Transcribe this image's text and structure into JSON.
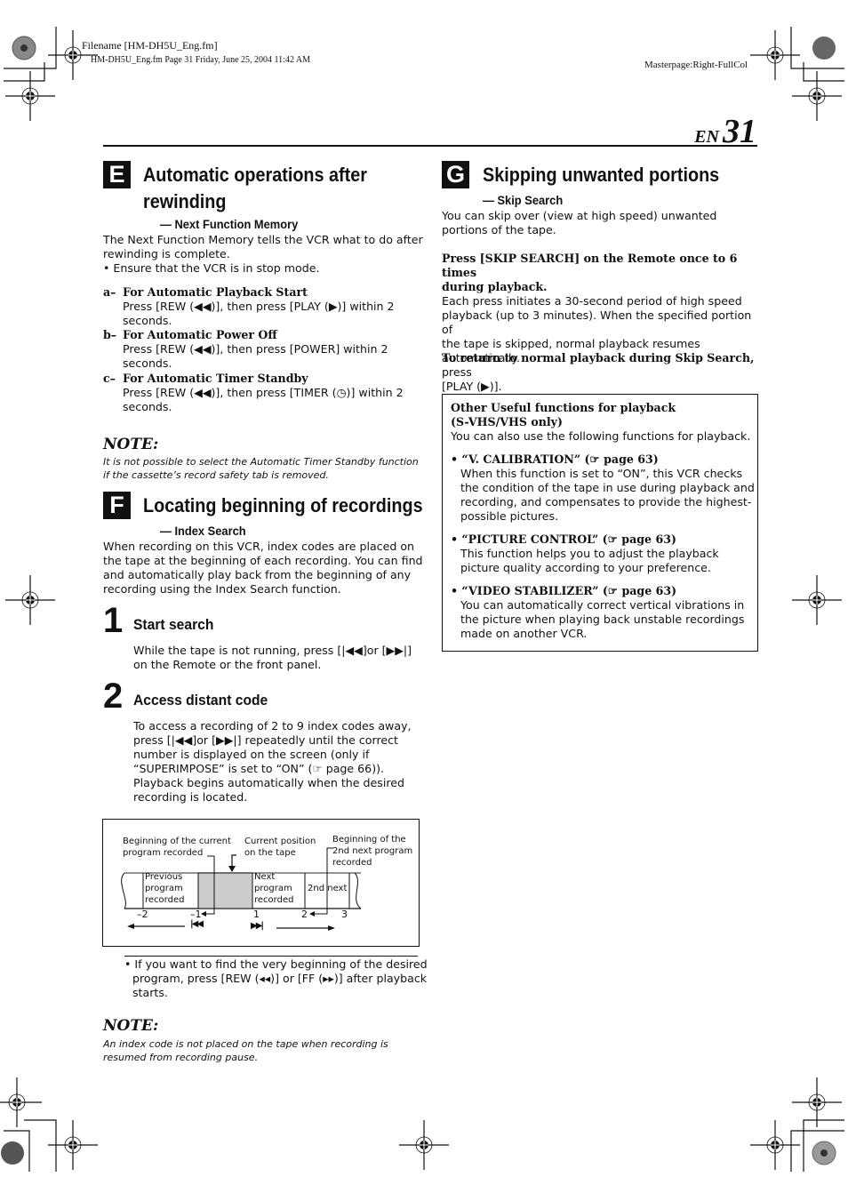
{
  "print_meta": {
    "filename": "Filename [HM-DH5U_Eng.fm]",
    "file_info": "HM-DH5U_Eng.fm  Page 31  Friday, June 25, 2004  11:42 AM",
    "masterpage": "Masterpage:Right-FullCol"
  },
  "page_number": {
    "lang": "EN",
    "number": "31"
  },
  "section_e": {
    "letter": "E",
    "title_line1": "Automatic operations after",
    "title_line2": "rewinding",
    "subtitle": "— Next Function Memory",
    "intro_line1": "The Next Function Memory tells the VCR what to do after",
    "intro_line2": "rewinding is complete.",
    "bullet": "• Ensure that the VCR is in stop mode.",
    "items": [
      {
        "marker": "a–",
        "title": "For Automatic Playback Start",
        "line1": "Press [REW (◀◀)], then press [PLAY (▶)] within 2",
        "line2": "seconds."
      },
      {
        "marker": "b–",
        "title": "For Automatic Power Off",
        "line1": "Press [REW (◀◀)], then press [POWER] within 2",
        "line2": "seconds."
      },
      {
        "marker": "c–",
        "title": "For Automatic Timer Standby",
        "line1": "Press [REW (◀◀)], then press [TIMER (◷)] within 2",
        "line2": "seconds."
      }
    ],
    "note_heading": "NOTE:",
    "note_line1": "It is not possible to select the Automatic Timer Standby function",
    "note_line2": "if the cassette’s record safety tab is removed."
  },
  "section_f": {
    "letter": "F",
    "title": "Locating beginning of recordings",
    "subtitle": "— Index Search",
    "intro_lines": [
      "When recording on this VCR, index codes are placed on",
      "the tape at the beginning of each recording. You can find",
      "and automatically play back from the beginning of any",
      "recording using the Index Search function."
    ],
    "steps": [
      {
        "number": "1",
        "title": "Start search",
        "lines": [
          "While the tape is not running, press [|◀◀]or [▶▶|]",
          "on the Remote or the front panel."
        ]
      },
      {
        "number": "2",
        "title": "Access distant code",
        "lines": [
          "To access a recording of 2 to 9 index codes away,",
          "press [|◀◀]or [▶▶|] repeatedly until the correct",
          "number is displayed on the screen (only if",
          "“SUPERIMPOSE” is set to “ON” (☞ page 66)).",
          "Playback begins automatically when the desired",
          "recording is located."
        ]
      }
    ],
    "diagram": {
      "label_current_begin_1": "Beginning of the current",
      "label_current_begin_2": "program recorded",
      "label_position_1": "Current position",
      "label_position_2": "on the tape",
      "label_2nd_begin_1": "Beginning of the",
      "label_2nd_begin_2": "2nd next program",
      "label_2nd_begin_3": "recorded",
      "seg_prev_1": "Previous",
      "seg_prev_2": "program",
      "seg_prev_3": "recorded",
      "seg_next_1": "Next",
      "seg_next_2": "program",
      "seg_next_3": "recorded",
      "seg_2nd": "2nd next",
      "ticks": [
        "–2",
        "–1",
        "1",
        "2",
        "3"
      ],
      "rew_symbol": "|◀◀",
      "ff_symbol": "▶▶|"
    },
    "tip_line1": "• If you want to find the very beginning of the desired",
    "tip_line2": "program, press [REW (◂◂)] or [FF (▸▸)]  after playback",
    "tip_line3": "starts.",
    "note_heading": "NOTE:",
    "note_line1": "An index code is not placed on the tape when recording is",
    "note_line2": "resumed from recording pause."
  },
  "section_g": {
    "letter": "G",
    "title": "Skipping unwanted portions",
    "subtitle": "— Skip Search",
    "intro_line1": "You can skip over (view at high speed) unwanted",
    "intro_line2": "portions of the tape.",
    "instr_bold_1": "Press [SKIP SEARCH] on the Remote once to 6 times",
    "instr_bold_2": "during playback.",
    "instr_lines": [
      "Each press initiates a 30-second period of high speed",
      "playback (up to 3 minutes). When the specified portion of",
      "the tape is skipped, normal playback resumes",
      "automatically."
    ],
    "return_bold": "To return to normal playback during Skip Search,",
    "return_rest": " press",
    "return_line2": "[PLAY (▶)].",
    "box": {
      "title1": "Other Useful functions for playback",
      "title2": "(S-VHS/VHS only)",
      "intro": "You can also use the following functions for playback.",
      "items": [
        {
          "heading": "• “V. CALIBRATION” (☞ page 63)",
          "lines": [
            "When this function is set to “ON”, this VCR checks",
            "the condition of the tape in use during playback and",
            "recording, and compensates to provide the highest-",
            "possible pictures."
          ]
        },
        {
          "heading": "• “PICTURE CONTROL” (☞ page 63)",
          "lines": [
            "This function helps you to adjust the playback",
            "picture quality according to your preference."
          ]
        },
        {
          "heading": "• “VIDEO STABILIZER” (☞ page 63)",
          "lines": [
            "You can automatically correct vertical vibrations in",
            "the picture when playing back unstable recordings",
            "made on another VCR."
          ]
        }
      ]
    }
  }
}
